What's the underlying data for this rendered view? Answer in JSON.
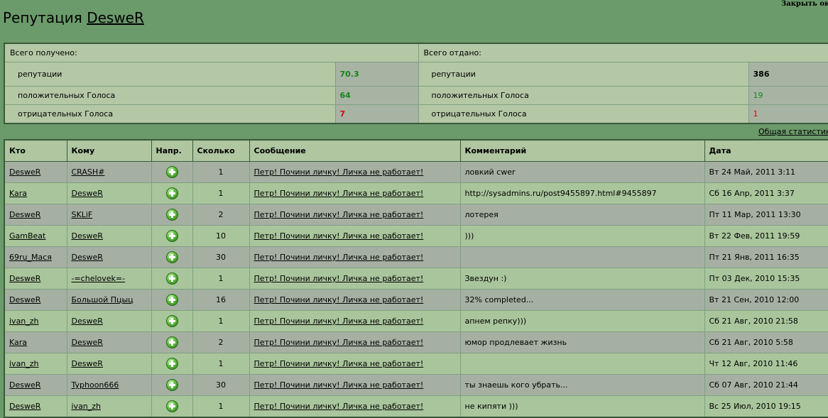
{
  "close_label": "Закрыть окно",
  "title": {
    "prefix": "Репутация",
    "user": "DesweR"
  },
  "stats": {
    "received_header": "Всего получено:",
    "given_header": "Всего отдано:",
    "rows": [
      {
        "label": "репутации",
        "received": "70.3",
        "given_label": "репутации",
        "given": "386"
      },
      {
        "label": "положительных Голоса",
        "received": "64",
        "given_label": "положительных Голоса",
        "given": "19"
      },
      {
        "label": "отрицательных Голоса",
        "received": "7",
        "given_label": "отрицательных Голоса",
        "given": "1"
      }
    ]
  },
  "general_stats_link": "Общая статистика",
  "table": {
    "headers": [
      "Кто",
      "Кому",
      "Напр.",
      "Сколько",
      "Сообщение",
      "Комментарий",
      "Дата"
    ],
    "rows": [
      {
        "from": "DesweR",
        "to": "CRASH#",
        "dir": "plus-icon",
        "amount": "1",
        "message": "Петр! Почини личку! Личка не работает!",
        "comment": "ловкий cwer",
        "date": "Вт 24 Май, 2011 3:11"
      },
      {
        "from": "Kara",
        "to": "DesweR",
        "dir": "plus-icon",
        "amount": "1",
        "message": "Петр! Почини личку! Личка не работает!",
        "comment": "http://sysadmins.ru/post9455897.html#9455897",
        "date": "Сб 16 Апр, 2011 3:37"
      },
      {
        "from": "DesweR",
        "to": "SKLiF",
        "dir": "plus-icon",
        "amount": "2",
        "message": "Петр! Почини личку! Личка не работает!",
        "comment": "лотерея",
        "date": "Пт 11 Мар, 2011 13:30"
      },
      {
        "from": "GamBeat",
        "to": "DesweR",
        "dir": "plus-icon",
        "amount": "10",
        "message": "Петр! Почини личку! Личка не работает!",
        "comment": ")))",
        "date": "Вт 22 Фев, 2011 19:59"
      },
      {
        "from": "69ru_Мася",
        "to": "DesweR",
        "dir": "plus-icon",
        "amount": "30",
        "message": "Петр! Почини личку! Личка не работает!",
        "comment": "",
        "date": "Пт 21 Янв, 2011 16:35"
      },
      {
        "from": "DesweR",
        "to": "-=chelovek=-",
        "dir": "plus-icon",
        "amount": "1",
        "message": "Петр! Почини личку! Личка не работает!",
        "comment": "Звездун :)",
        "date": "Пт 03 Дек, 2010 15:35"
      },
      {
        "from": "DesweR",
        "to": "Большой Пцыц",
        "dir": "plus-icon",
        "amount": "16",
        "message": "Петр! Почини личку! Личка не работает!",
        "comment": "32% completed...",
        "date": "Вт 21 Сен, 2010 12:00"
      },
      {
        "from": "ivan_zh",
        "to": "DesweR",
        "dir": "plus-icon",
        "amount": "1",
        "message": "Петр! Почини личку! Личка не работает!",
        "comment": "апнем репку)))",
        "date": "Сб 21 Авг, 2010 21:58"
      },
      {
        "from": "Kara",
        "to": "DesweR",
        "dir": "plus-icon",
        "amount": "2",
        "message": "Петр! Почини личку! Личка не работает!",
        "comment": "юмор продлевает жизнь",
        "date": "Сб 21 Авг, 2010 5:58"
      },
      {
        "from": "ivan_zh",
        "to": "DesweR",
        "dir": "plus-icon",
        "amount": "1",
        "message": "Петр! Почини личку! Личка не работает!",
        "comment": "",
        "date": "Чт 12 Авг, 2010 11:46"
      },
      {
        "from": "DesweR",
        "to": "Typhoon666",
        "dir": "plus-icon",
        "amount": "30",
        "message": "Петр! Почини личку! Личка не работает!",
        "comment": "ты знаешь кого убрать...",
        "date": "Сб 07 Авг, 2010 21:44"
      },
      {
        "from": "DesweR",
        "to": "ivan_zh",
        "dir": "plus-icon",
        "amount": "1",
        "message": "Петр! Почини личку! Личка не работает!",
        "comment": "не кипяти )))",
        "date": "Вс 25 Июл, 2010 19:15"
      }
    ]
  },
  "colors": {
    "page_bg": "#6b9a6b",
    "row_gray": "#a5b0a2",
    "row_green": "#a9c59c",
    "positive": "#188418",
    "negative": "#e00000"
  }
}
